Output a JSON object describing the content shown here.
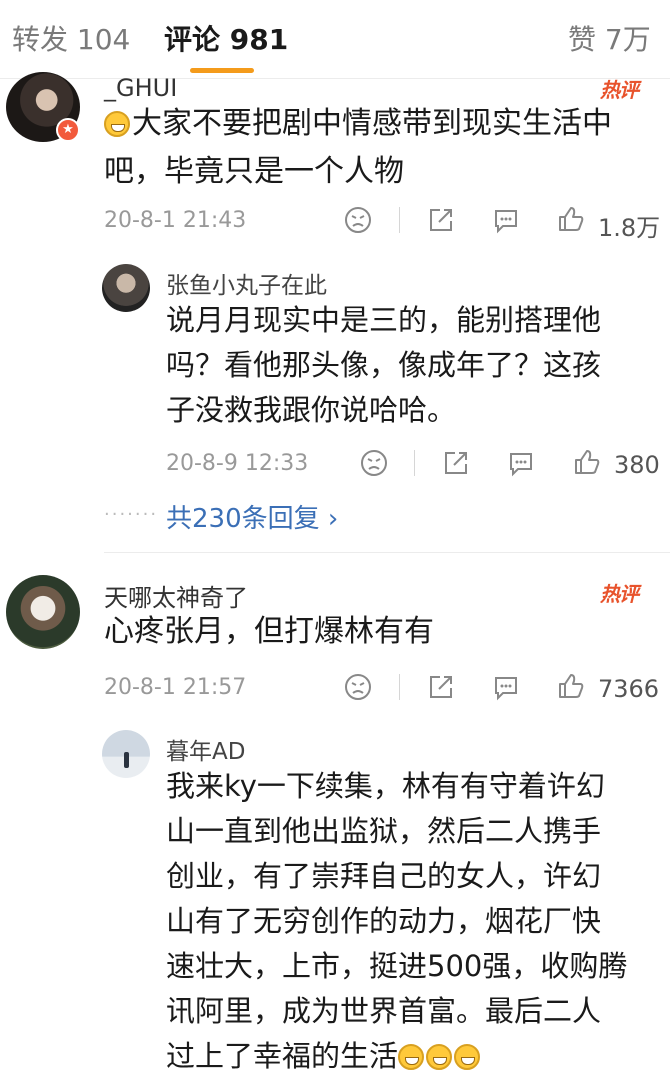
{
  "tabs": [
    {
      "label": "转发 104"
    },
    {
      "label": "评论 981"
    },
    {
      "label": "赞 7万"
    }
  ],
  "accent_color": "#f49b1b",
  "hot_color": "#e8532c",
  "link_color": "#3b6fb6",
  "comments": [
    {
      "username": "_GHUI",
      "hot_tag": "热评",
      "text_lines": [
        "大家不要把剧中情感带到现实生活中",
        "吧，毕竟只是一个人物"
      ],
      "emoji": "crying-laughing-emoji",
      "time": "20-8-1 21:43",
      "likes": "1.8万",
      "reply": {
        "username": "张鱼小丸子在此",
        "text_lines": [
          "说月月现实中是三的，能别搭理他",
          "吗？看他那头像，像成年了？这孩",
          "子没救我跟你说哈哈。"
        ],
        "time": "20-8-9 12:33",
        "likes": "380"
      },
      "replies_link": "共230条回复 ›"
    },
    {
      "username": "天哪太神奇了",
      "hot_tag": "热评",
      "text_lines": [
        "心疼张月，但打爆林有有"
      ],
      "time": "20-8-1 21:57",
      "likes": "7366",
      "reply": {
        "username": "暮年AD",
        "text_lines": [
          "我来ky一下续集，林有有守着许幻",
          "山一直到他出监狱，然后二人携手",
          "创业，有了崇拜自己的女人，许幻",
          "山有了无穷创作的动力，烟花厂快",
          "速壮大，上市，挺进500强，收购腾",
          "讯阿里，成为世界首富。最后二人",
          "过上了幸福的生活"
        ],
        "trailing_emoji": "grinning-emoji ×3"
      }
    }
  ],
  "dots": "·······"
}
